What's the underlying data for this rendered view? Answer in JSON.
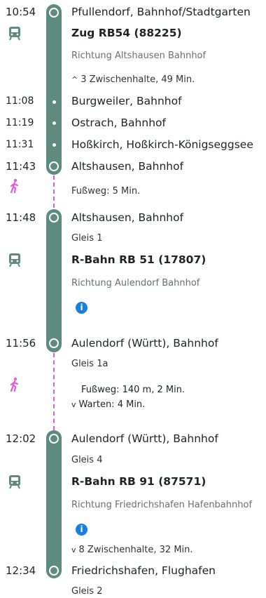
{
  "legs": [
    {
      "type": "train",
      "start_time": "10:54",
      "start_stop": "Pfullendorf, Bahnhof/Stadtgarten",
      "train": "Zug RB54 (88225)",
      "direction": "Richtung Altshausen Bahnhof",
      "intermediate": "3 Zwischenhalte, 49 Min.",
      "stops": [
        {
          "time": "11:08",
          "name": "Burgweiler, Bahnhof"
        },
        {
          "time": "11:19",
          "name": "Ostrach, Bahnhof"
        },
        {
          "time": "11:31",
          "name": "Hoßkirch, Hoßkirch-Königseggsee"
        }
      ],
      "end_time": "11:43",
      "end_stop": "Altshausen, Bahnhof"
    },
    {
      "type": "walk",
      "text": "Fußweg: 5 Min."
    },
    {
      "type": "train",
      "start_time": "11:48",
      "start_stop": "Altshausen, Bahnhof",
      "platform": "Gleis 1",
      "train": "R-Bahn RB 51 (17807)",
      "direction": "Richtung Aulendorf Bahnhof",
      "end_time": "11:56",
      "end_stop": "Aulendorf (Württ), Bahnhof",
      "end_platform": "Gleis 1a"
    },
    {
      "type": "walk",
      "text": "Fußweg: 140 m, 2 Min.",
      "wait": "Warten: 4 Min."
    },
    {
      "type": "train",
      "start_time": "12:02",
      "start_stop": "Aulendorf (Württ), Bahnhof",
      "platform": "Gleis 4",
      "train": "R-Bahn RB 91 (87571)",
      "direction": "Richtung Friedrichshafen Hafenbahnhof",
      "intermediate": "8 Zwischenhalte, 32 Min.",
      "end_time": "12:34",
      "end_stop": "Friedrichshafen, Flughafen",
      "end_platform": "Gleis 2"
    }
  ],
  "icons": {
    "train": "train-icon",
    "walk": "walk-icon",
    "info": "info-icon",
    "chevron_up": "chevron-up-icon",
    "chevron_down": "chevron-down-icon"
  },
  "info_glyph": "i",
  "colors": {
    "line": "#5d8b7e",
    "walk": "#e65ad6",
    "info": "#1a7fe0"
  }
}
